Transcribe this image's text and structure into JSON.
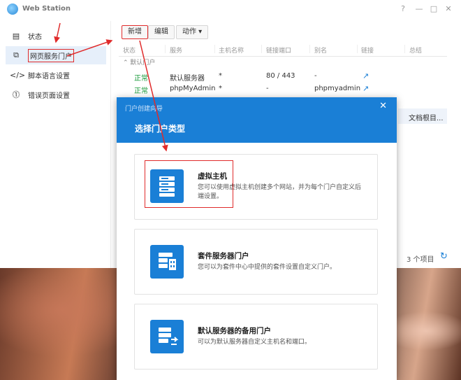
{
  "app": {
    "title": "Web Station",
    "window_controls": [
      "?",
      "—",
      "□",
      "✕"
    ]
  },
  "sidebar": {
    "items": [
      {
        "label": "状态",
        "icon": "status-icon",
        "active": false
      },
      {
        "label": "网页服务门户",
        "icon": "portal-icon",
        "active": true
      },
      {
        "label": "脚本语言设置",
        "icon": "code-icon",
        "active": false
      },
      {
        "label": "错误页面设置",
        "icon": "error-page-icon",
        "active": false
      }
    ]
  },
  "toolbar": {
    "new_label": "新增",
    "edit_label": "编辑",
    "action_label": "动作 ▾"
  },
  "grid": {
    "columns": [
      "状态",
      "服务",
      "主机名称",
      "链接端口",
      "别名",
      "链接",
      "总结"
    ],
    "group_label": "⌃ 默认门户",
    "rows": [
      {
        "status": "正常",
        "service": "默认服务器",
        "host": "*",
        "port": "80 / 443",
        "alias": "-"
      },
      {
        "status": "正常",
        "service": "phpMyAdmin",
        "host": "*",
        "port": "-",
        "alias": "phpmyadmin"
      }
    ],
    "doc_root": "文档根目...",
    "item_count": "3 个项目"
  },
  "modal": {
    "title": "门户创建向导",
    "subtitle": "选择门户类型",
    "options": [
      {
        "title": "虚拟主机",
        "desc": "您可以使用虚拟主机创建多个网站，并为每个门户自定义后端设置。",
        "icon": "server-icon"
      },
      {
        "title": "套件服务器门户",
        "desc": "您可以为套件中心中提供的套件设置自定义门户。",
        "icon": "package-server-icon"
      },
      {
        "title": "默认服务器的备用门户",
        "desc": "可以为默认服务器自定义主机名和端口。",
        "icon": "server-redirect-icon"
      }
    ]
  },
  "colors": {
    "accent": "#1a7fd6",
    "highlight": "#e02b2b",
    "ok": "#1a9a3a"
  }
}
